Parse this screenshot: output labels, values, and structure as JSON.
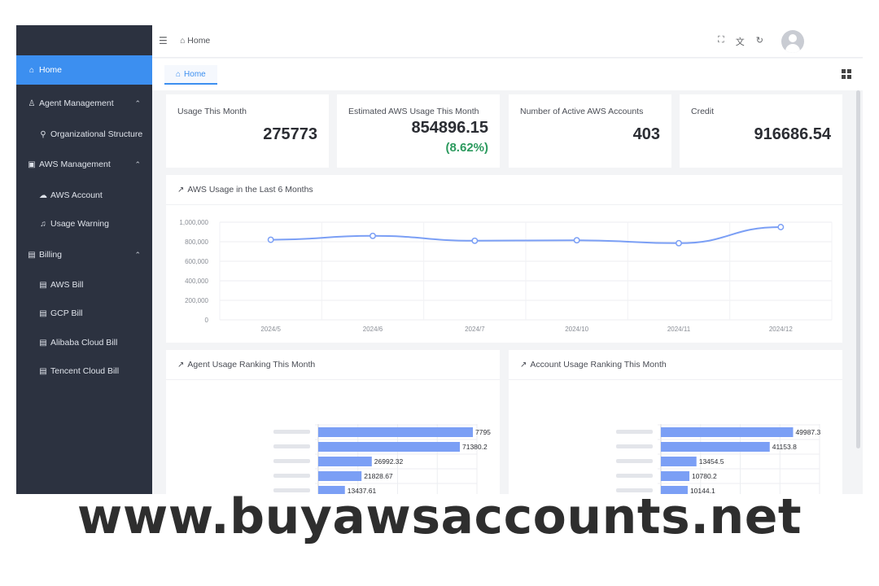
{
  "header": {
    "breadcrumb": "Home",
    "breadcrumb_icon": "home-icon",
    "icons": [
      "fullscreen-icon",
      "translate-icon",
      "refresh-icon"
    ]
  },
  "sidebar": {
    "items": [
      {
        "label": "Home",
        "icon": "home-icon",
        "level": 1,
        "active": true
      },
      {
        "label": "Agent Management",
        "icon": "users-icon",
        "level": 1,
        "expanded": true
      },
      {
        "label": "Organizational Structure",
        "icon": "org-icon",
        "level": 2
      },
      {
        "label": "AWS Management",
        "icon": "server-icon",
        "level": 1,
        "expanded": true
      },
      {
        "label": "AWS Account",
        "icon": "cloud-icon",
        "level": 2
      },
      {
        "label": "Usage Warning",
        "icon": "bell-icon",
        "level": 2
      },
      {
        "label": "Billing",
        "icon": "document-icon",
        "level": 1,
        "expanded": true
      },
      {
        "label": "AWS Bill",
        "icon": "document-icon",
        "level": 2
      },
      {
        "label": "GCP Bill",
        "icon": "document-icon",
        "level": 2
      },
      {
        "label": "Alibaba Cloud Bill",
        "icon": "document-icon",
        "level": 2
      },
      {
        "label": "Tencent Cloud Bill",
        "icon": "document-icon",
        "level": 2
      }
    ]
  },
  "tabs": [
    {
      "label": "Home",
      "active": true
    }
  ],
  "stats": [
    {
      "label": "Usage This Month",
      "value": "275773"
    },
    {
      "label": "Estimated AWS Usage This Month",
      "value": "854896.15",
      "change": "(8.62%)"
    },
    {
      "label": "Number of Active AWS Accounts",
      "value": "403"
    },
    {
      "label": "Credit",
      "value": "916686.54"
    }
  ],
  "colors": {
    "sidebar_bg": "#2c3240",
    "accent": "#3c8ff0",
    "bar": "#7b9ff5",
    "line": "#7b9ff5",
    "positive": "#2c9a5e"
  },
  "chart_data": [
    {
      "type": "line",
      "title": "AWS Usage in the Last 6 Months",
      "categories": [
        "2024/5",
        "2024/6",
        "2024/7",
        "2024/10",
        "2024/11",
        "2024/12"
      ],
      "values": [
        820000,
        860000,
        810000,
        815000,
        785000,
        950000
      ],
      "ylim": [
        0,
        1000000
      ],
      "yticks": [
        "0",
        "200,000",
        "400,000",
        "600,000",
        "800,000",
        "1,000,000"
      ],
      "grid": true
    },
    {
      "type": "bar",
      "orientation": "horizontal",
      "title": "Agent Usage Ranking This Month",
      "values": [
        77950,
        71380.21,
        26992.32,
        21828.67,
        13437.61
      ],
      "value_labels": [
        "7795",
        "71380.2",
        "26992.32",
        "21828.67",
        "13437.61"
      ],
      "xlim": [
        0,
        80000
      ],
      "grid": true
    },
    {
      "type": "bar",
      "orientation": "horizontal",
      "title": "Account Usage Ranking This Month",
      "values": [
        49987.3,
        41153.8,
        13454.5,
        10780.2,
        10144.1
      ],
      "value_labels": [
        "49987.3",
        "41153.8",
        "13454.5",
        "10780.2",
        "10144.1"
      ],
      "xlim": [
        0,
        60000
      ],
      "grid": true
    }
  ],
  "watermark": "www.buyawsaccounts.net"
}
